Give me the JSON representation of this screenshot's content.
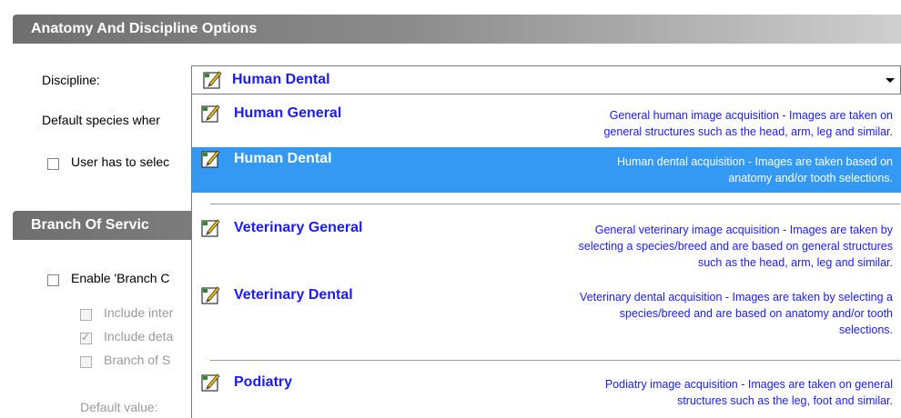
{
  "sections": {
    "anatomy_header": "Anatomy And Discipline Options",
    "branch_header": "Branch Of Servic"
  },
  "labels": {
    "discipline": "Discipline:",
    "default_species": "Default species wher",
    "user_has_to_select": "User has to selec",
    "enable_branch": "Enable 'Branch C",
    "include_inter": "Include inter",
    "include_deta": "Include deta",
    "branch_of_s": "Branch of S",
    "default_value": "Default value:"
  },
  "combo": {
    "selected_value": "Human Dental"
  },
  "options": [
    {
      "title": "Human General",
      "desc_lines": [
        "General human image acquisition - Images are taken on",
        "general structures such as the head, arm, leg and similar."
      ],
      "selected": false
    },
    {
      "title": "Human Dental",
      "desc_lines": [
        "Human dental acquisition - Images are taken based on",
        "anatomy and/or tooth selections."
      ],
      "selected": true
    },
    {
      "title": "Veterinary General",
      "desc_lines": [
        "General veterinary image acquisition - Images are taken by",
        "selecting a species/breed and are based on general structures",
        "such as the head, arm, leg and similar."
      ],
      "selected": false
    },
    {
      "title": "Veterinary Dental",
      "desc_lines": [
        "Veterinary dental acquisition - Images are taken by selecting a",
        "species/breed and are based on anatomy and/or tooth",
        "selections."
      ],
      "selected": false
    },
    {
      "title": "Podiatry",
      "desc_lines": [
        "Podiatry image acquisition - Images are taken on general",
        "structures such as the leg, foot and similar."
      ],
      "selected": false
    }
  ],
  "icon_name": "pencil-edit-icon",
  "colors": {
    "selection": "#3399f3",
    "option_text": "#1a1aff"
  }
}
